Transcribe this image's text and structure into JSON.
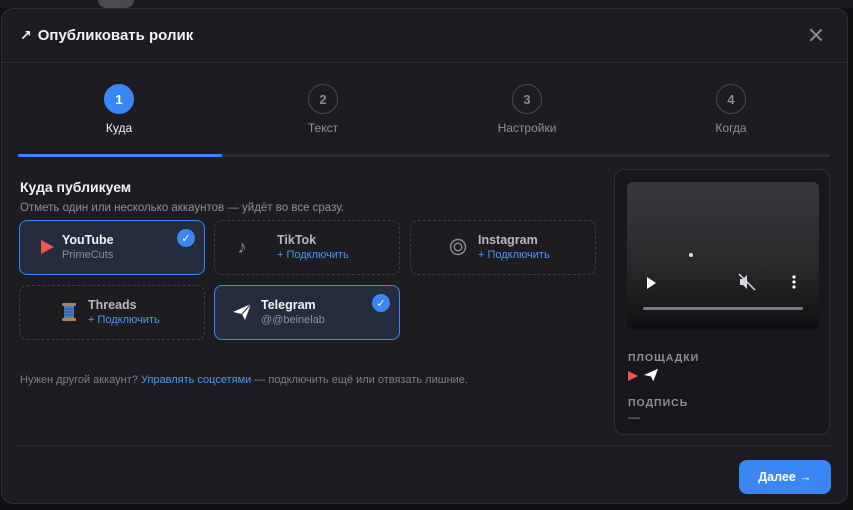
{
  "modal": {
    "title": "Опубликовать ролик",
    "title_icon": "arrow-up-right-icon"
  },
  "steps": [
    {
      "number": "1",
      "label": "Куда",
      "active": true
    },
    {
      "number": "2",
      "label": "Текст",
      "active": false
    },
    {
      "number": "3",
      "label": "Настройки",
      "active": false
    },
    {
      "number": "4",
      "label": "Когда",
      "active": false
    }
  ],
  "progress": {
    "current_step": 1,
    "total_steps": 4
  },
  "section": {
    "title": "Куда публикуем",
    "subtitle": "Отметь один или несколько аккаунтов — уйдёт во все сразу."
  },
  "accounts": [
    {
      "name": "YouTube",
      "handle": "PrimeCuts",
      "selected": true,
      "icon": "youtube-play-icon",
      "color": "#ef5350"
    },
    {
      "name": "TikTok",
      "action": "+ Подключить",
      "selected": false,
      "icon": "music-note-icon"
    },
    {
      "name": "Instagram",
      "action": "+ Подключить",
      "selected": false,
      "icon": "instagram-icon"
    },
    {
      "name": "Threads",
      "action": "+ Подключить",
      "selected": false,
      "icon": "thread-spool-icon"
    },
    {
      "name": "Telegram",
      "handle": "@@beinelab",
      "selected": true,
      "icon": "paper-plane-icon"
    }
  ],
  "help": {
    "prefix": "Нужен другой аккаунт? ",
    "link": "Управлять соцсетями",
    "suffix": " — подключить ещё или отвязать лишние."
  },
  "preview": {
    "platforms_label": "ПЛОЩАДКИ",
    "caption_label": "ПОДПИСЬ",
    "caption_value": "—",
    "platform_icons": [
      "youtube-play-icon",
      "paper-plane-icon"
    ]
  },
  "footer": {
    "next_label": "Далее →"
  },
  "colors": {
    "accent": "#3a86f5",
    "link": "#4d95f7",
    "youtube": "#ef5350"
  }
}
